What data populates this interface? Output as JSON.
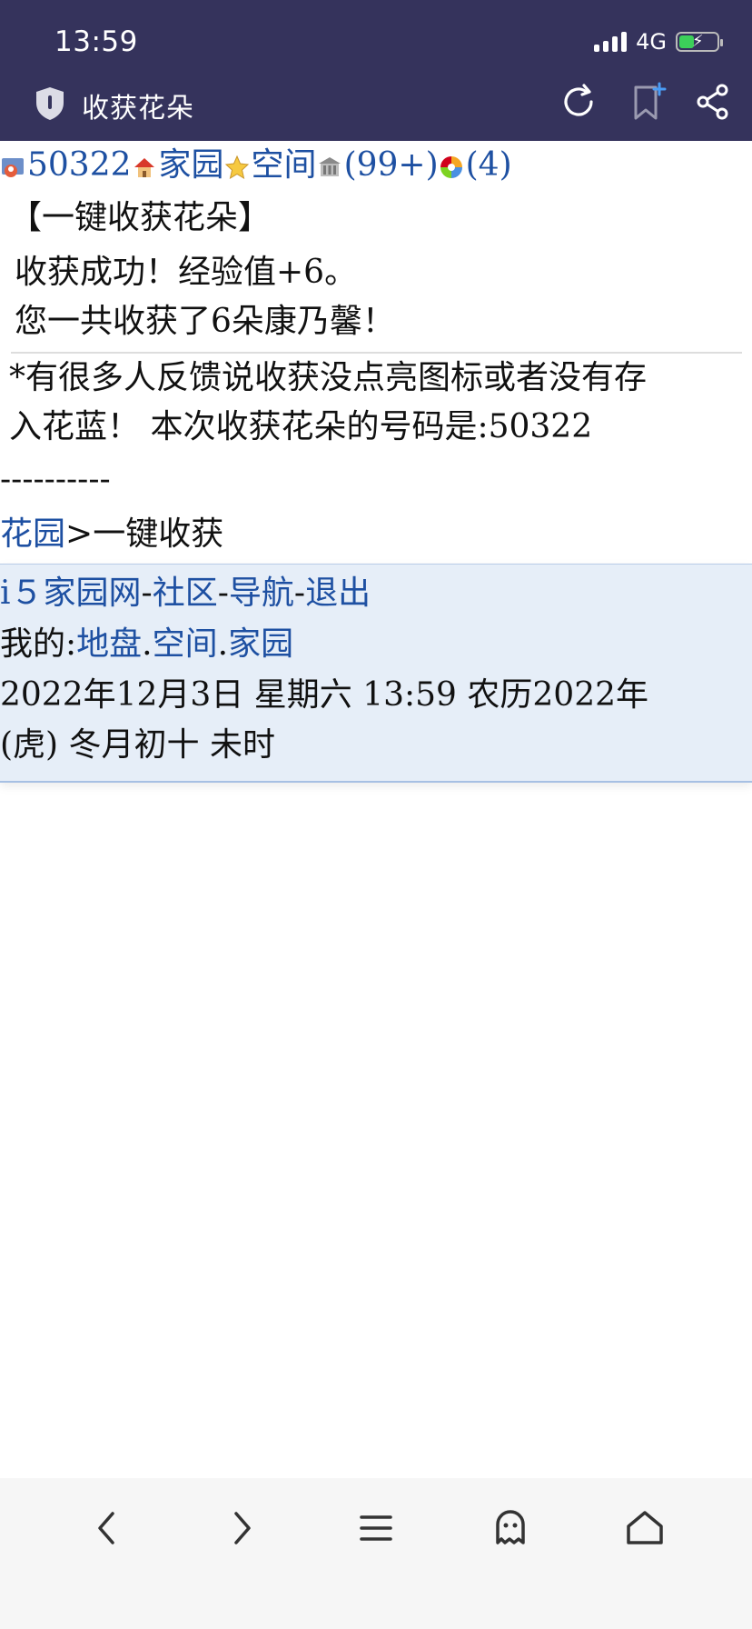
{
  "status": {
    "time": "13:59",
    "network": "4G"
  },
  "titlebar": {
    "title": "收获花朵"
  },
  "nav_links": {
    "user_id": "50322",
    "home": "家园",
    "space": "空间",
    "messages": "(99+)",
    "extra": "(4)"
  },
  "content": {
    "heading": "【一键收获花朵】",
    "result_line1": "收获成功！经验值+6。",
    "result_line2": "您一共收获了6朵康乃馨！",
    "notice_line1": "*有很多人反馈说收获没点亮图标或者没有存",
    "notice_line2": "入花蓝！ 本次收获花朵的号码是:50322",
    "dashes": "----------",
    "breadcrumb_link": "花园",
    "breadcrumb_sep": ">",
    "breadcrumb_current": "一键收获"
  },
  "footer": {
    "site": "i５家园网",
    "sep1": "-",
    "community": "社区",
    "sep2": "-",
    "nav": "导航",
    "sep3": "-",
    "logout": "退出",
    "mine_label": "我的:",
    "land": "地盘",
    "dot1": ".",
    "space": "空间",
    "dot2": ".",
    "home": "家园",
    "date_line1": "2022年12月3日  星期六  13:59  农历2022年",
    "date_line2": "(虎)  冬月初十  未时"
  },
  "icons": {
    "back": "chevron-left-icon",
    "forward": "chevron-right-icon",
    "menu": "menu-icon",
    "ghost": "ghost-icon",
    "home": "home-icon"
  },
  "colors": {
    "header_bg": "#35335c",
    "link": "#1e50a2",
    "panel_bg": "#e6eef8"
  }
}
